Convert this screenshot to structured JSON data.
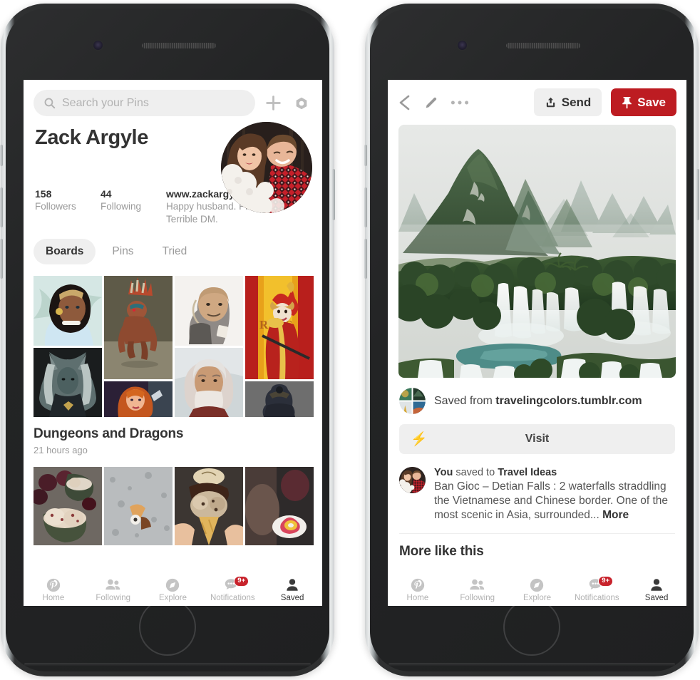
{
  "app": {
    "brand_red": "#bd1c22",
    "badge_red": "#c8232c"
  },
  "left_phone": {
    "search": {
      "placeholder": "Search your Pins",
      "icon": "search-icon"
    },
    "add_icon": "plus-icon",
    "settings_icon": "gear-icon",
    "profile": {
      "name": "Zack Argyle",
      "followers_count": "158",
      "followers_label": "Followers",
      "following_count": "44",
      "following_label": "Following",
      "website": "www.zackargyle.com",
      "bio": "Happy husband. Proud dad. Terrible DM."
    },
    "tabs": [
      {
        "label": "Boards",
        "active": true
      },
      {
        "label": "Pins",
        "active": false
      },
      {
        "label": "Tried",
        "active": false
      }
    ],
    "boards": [
      {
        "title": "Dungeons and Dragons",
        "subtitle": "21 hours ago"
      },
      {
        "title": "",
        "subtitle": ""
      }
    ],
    "bottom_nav": [
      {
        "label": "Home",
        "icon": "pinterest-icon",
        "active": false,
        "badge": ""
      },
      {
        "label": "Following",
        "icon": "people-icon",
        "active": false,
        "badge": ""
      },
      {
        "label": "Explore",
        "icon": "compass-icon",
        "active": false,
        "badge": ""
      },
      {
        "label": "Notifications",
        "icon": "chat-bubble-icon",
        "active": false,
        "badge": "9+"
      },
      {
        "label": "Saved",
        "icon": "person-icon",
        "active": true,
        "badge": ""
      }
    ]
  },
  "right_phone": {
    "header": {
      "back_icon": "chevron-left-icon",
      "edit_icon": "pencil-icon",
      "more_icon": "ellipsis-icon",
      "send_label": "Send",
      "send_icon": "share-upload-icon",
      "save_label": "Save",
      "save_icon": "pin-icon"
    },
    "source": {
      "prefix": "Saved from ",
      "domain": "travelingcolors.tumblr.com"
    },
    "visit": {
      "label": "Visit",
      "icon": "bolt-icon"
    },
    "description": {
      "actor": "You",
      "middle": " saved to ",
      "board": "Travel Ideas",
      "body": "Ban Gioc – Detian Falls : 2 waterfalls straddling the Vietnamese and Chinese border. One of the most scenic in Asia, surrounded... ",
      "more": "More"
    },
    "more_like_this": "More like this",
    "bottom_nav": [
      {
        "label": "Home",
        "icon": "pinterest-icon",
        "active": false,
        "badge": ""
      },
      {
        "label": "Following",
        "icon": "people-icon",
        "active": false,
        "badge": ""
      },
      {
        "label": "Explore",
        "icon": "compass-icon",
        "active": false,
        "badge": ""
      },
      {
        "label": "Notifications",
        "icon": "chat-bubble-icon",
        "active": false,
        "badge": "9+"
      },
      {
        "label": "Saved",
        "icon": "person-icon",
        "active": true,
        "badge": ""
      }
    ]
  }
}
